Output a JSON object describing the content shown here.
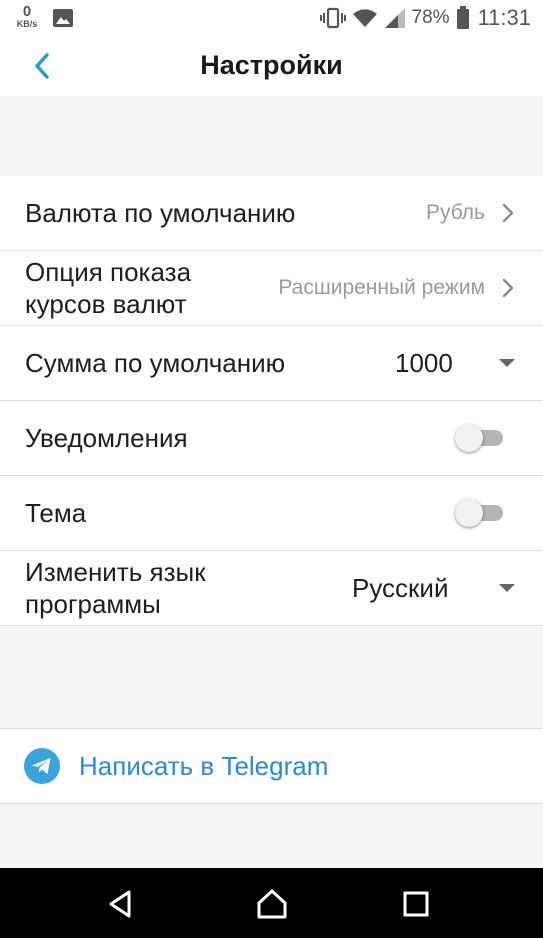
{
  "status_bar": {
    "speed_value": "0",
    "speed_unit": "KB/s",
    "battery_percent": "78%",
    "time": "11:31",
    "icons": [
      "image-icon",
      "vibrate-icon",
      "wifi-icon",
      "signal-icon",
      "battery-icon"
    ]
  },
  "header": {
    "title": "Настройки",
    "back_icon": "chevron-left-icon"
  },
  "settings": {
    "default_currency": {
      "label": "Валюта по умолчанию",
      "value": "Рубль"
    },
    "rates_display": {
      "label": "Опция показа курсов валют",
      "value": "Расширенный режим"
    },
    "default_amount": {
      "label": "Сумма по умолчанию",
      "value": "1000"
    },
    "notifications": {
      "label": "Уведомления",
      "enabled": false
    },
    "theme": {
      "label": "Тема",
      "enabled": false
    },
    "language": {
      "label": "Изменить язык программы",
      "value": "Русский"
    }
  },
  "telegram": {
    "label": "Написать в Telegram",
    "icon": "telegram-icon"
  },
  "colors": {
    "accent": "#2b8ad8",
    "back_arrow": "#2a9bd0",
    "background": "#f5f5f7",
    "nav_bar": "#000000"
  },
  "nav_bar": {
    "icons": [
      "back-triangle-icon",
      "home-icon",
      "recents-icon"
    ]
  }
}
